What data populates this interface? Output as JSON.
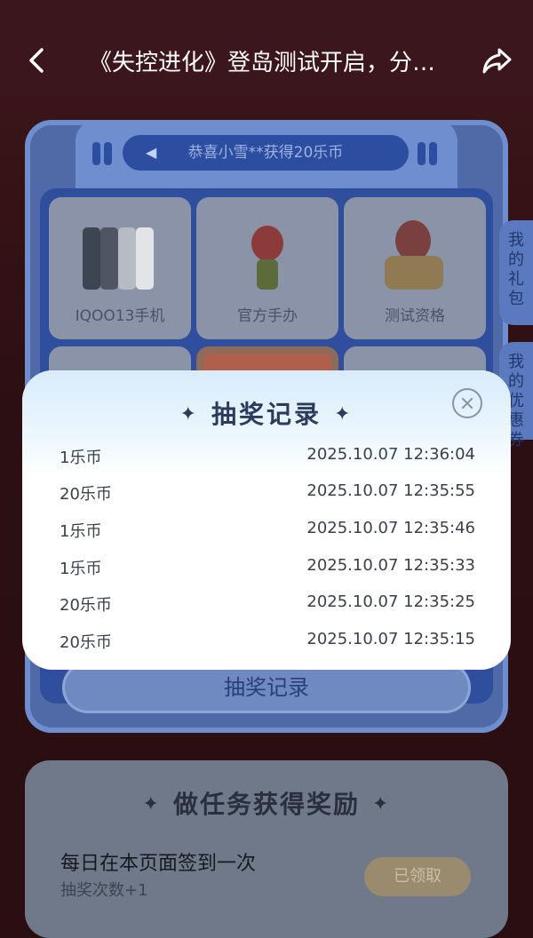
{
  "header": {
    "title": "《失控进化》登岛测试开启，分…"
  },
  "ticker": {
    "text": "恭喜小雪**获得20乐币"
  },
  "prizes": [
    {
      "label": "IQOO13手机"
    },
    {
      "label": "官方手办"
    },
    {
      "label": "测试资格"
    }
  ],
  "side_tabs": [
    {
      "label": "我的礼包"
    },
    {
      "label": "我的优惠券"
    }
  ],
  "draw_record_button": "抽奖记录",
  "modal": {
    "title": "抽奖记录",
    "records": [
      {
        "amount": "1乐币",
        "time": "2025.10.07 12:36:04"
      },
      {
        "amount": "20乐币",
        "time": "2025.10.07 12:35:55"
      },
      {
        "amount": "1乐币",
        "time": "2025.10.07 12:35:46"
      },
      {
        "amount": "1乐币",
        "time": "2025.10.07 12:35:33"
      },
      {
        "amount": "20乐币",
        "time": "2025.10.07 12:35:25"
      },
      {
        "amount": "20乐币",
        "time": "2025.10.07 12:35:15"
      }
    ]
  },
  "tasks": {
    "title": "做任务获得奖励",
    "item": "每日在本页面签到一次",
    "sub": "抽奖次数+1",
    "button": "已领取"
  },
  "colors": {
    "accent_blue": "#2c4da0",
    "modal_title": "#2c3a5c"
  }
}
